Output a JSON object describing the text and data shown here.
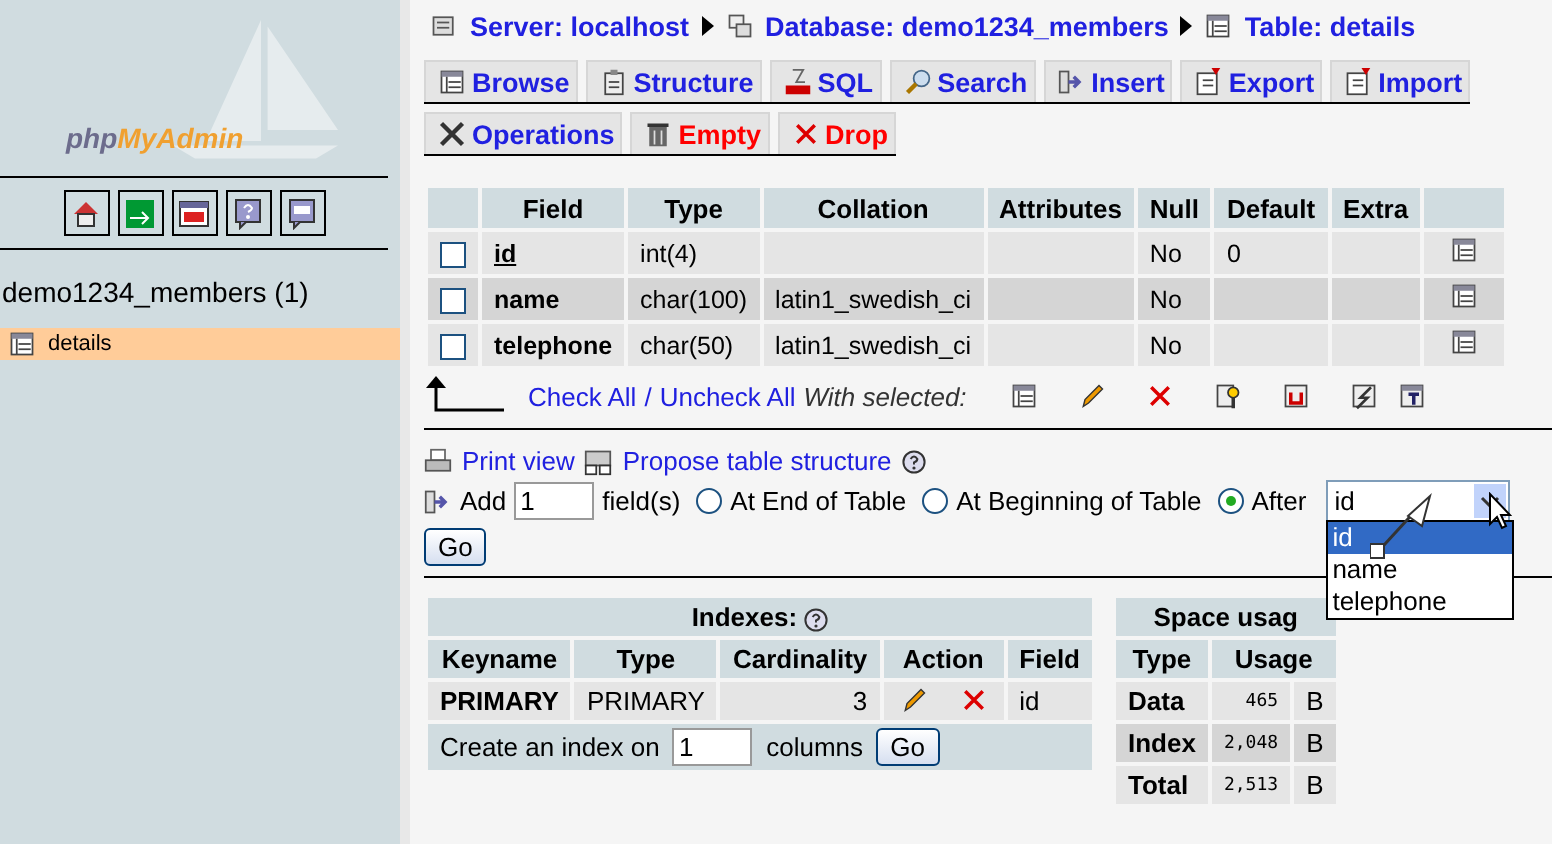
{
  "sidebar": {
    "logo": {
      "prefix": "php",
      "name": "MyAdmin"
    },
    "database": "demo1234_members (1)",
    "tables": [
      {
        "name": "details",
        "selected": true
      }
    ]
  },
  "breadcrumb": [
    {
      "kind": "server",
      "label": "Server: localhost"
    },
    {
      "kind": "database",
      "label": "Database: demo1234_members"
    },
    {
      "kind": "table",
      "label": "Table: details"
    }
  ],
  "tab_rows": [
    [
      {
        "kind": "browse",
        "label": "Browse",
        "danger": false
      },
      {
        "kind": "structure",
        "label": "Structure",
        "danger": false
      },
      {
        "kind": "sql",
        "label": "SQL",
        "danger": false
      },
      {
        "kind": "search",
        "label": "Search",
        "danger": false
      },
      {
        "kind": "insert",
        "label": "Insert",
        "danger": false
      },
      {
        "kind": "export",
        "label": "Export",
        "danger": false
      },
      {
        "kind": "import",
        "label": "Import",
        "danger": false
      }
    ],
    [
      {
        "kind": "operations",
        "label": "Operations",
        "danger": false
      },
      {
        "kind": "empty",
        "label": "Empty",
        "danger": true
      },
      {
        "kind": "drop",
        "label": "Drop",
        "danger": true
      }
    ]
  ],
  "structure_table": {
    "columns": [
      "Field",
      "Type",
      "Collation",
      "Attributes",
      "Null",
      "Default",
      "Extra"
    ],
    "rows": [
      {
        "checked": false,
        "field": "id",
        "primary": true,
        "type": "int(4)",
        "null": "No",
        "default": "0"
      },
      {
        "checked": false,
        "field": "name",
        "primary": false,
        "type": "char(100)",
        "collation": "latin1_swedish_ci",
        "null": "No"
      },
      {
        "checked": false,
        "field": "telephone",
        "primary": false,
        "type": "char(50)",
        "collation": "latin1_swedish_ci",
        "null": "No"
      }
    ]
  },
  "bulk": {
    "check_all": "Check All",
    "separator": "/",
    "uncheck_all": "Uncheck All",
    "with_selected": "With selected:",
    "actions": [
      {
        "kind": "browse"
      },
      {
        "kind": "edit"
      },
      {
        "kind": "drop"
      },
      {
        "kind": "primary"
      },
      {
        "kind": "unique"
      },
      {
        "kind": "index"
      },
      {
        "kind": "fulltext"
      }
    ]
  },
  "links": [
    {
      "kind": "print",
      "label": "Print view"
    },
    {
      "kind": "propose",
      "label": "Propose table structure"
    }
  ],
  "add_fields": {
    "add": "Add",
    "count": "1",
    "fields_label": "field(s)",
    "positions": [
      {
        "label": "At End of Table",
        "selected": false
      },
      {
        "label": "At Beginning of Table",
        "selected": false
      },
      {
        "label": "After",
        "selected": true
      }
    ],
    "after_select": {
      "value": "id",
      "expanded": true,
      "options": [
        {
          "label": "id",
          "selected": true
        },
        {
          "label": "name",
          "selected": false
        },
        {
          "label": "telephone",
          "selected": false
        }
      ]
    },
    "go": "Go"
  },
  "indexes": {
    "title": "Indexes:",
    "columns": [
      "Keyname",
      "Type",
      "Cardinality",
      "Action",
      "Field"
    ],
    "rows": [
      {
        "keyname": "PRIMARY",
        "type": "PRIMARY",
        "cardinality": "3",
        "field": "id"
      }
    ],
    "create_label": "Create an index on",
    "create_count": "1",
    "columns_label": "columns",
    "go": "Go"
  },
  "space_usage": {
    "title": "Space usag",
    "columns": [
      "Type",
      "Usage"
    ],
    "rows": [
      {
        "type": "Data",
        "value": "465",
        "unit": "B"
      },
      {
        "type": "Index",
        "value": "2,048",
        "unit": "B"
      },
      {
        "type": "Total",
        "value": "2,513",
        "unit": "B"
      }
    ]
  }
}
